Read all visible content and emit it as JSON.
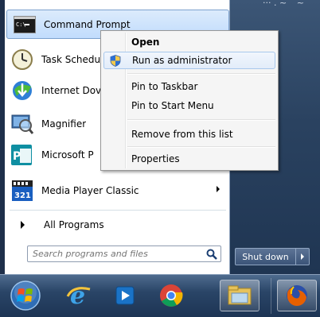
{
  "start_menu": {
    "top_right_text": "···  . ~ ˙ ~ ˙",
    "programs": [
      {
        "label": "Command Prompt",
        "icon": "command-prompt-icon"
      },
      {
        "label": "Task Schedu",
        "icon": "task-scheduler-icon"
      },
      {
        "label": "Internet Dov",
        "icon": "internet-download-icon"
      },
      {
        "label": "Magnifier",
        "icon": "magnifier-icon"
      },
      {
        "label": "Microsoft P",
        "icon": "microsoft-publisher-icon"
      },
      {
        "label": "Media Player Classic",
        "icon": "media-player-classic-icon"
      }
    ],
    "all_programs": "All Programs",
    "search_placeholder": "Search programs and files",
    "shutdown_label": "Shut down"
  },
  "context_menu": {
    "items": [
      {
        "label": "Open"
      },
      {
        "label": "Run as administrator"
      },
      {
        "label": "Pin to Taskbar"
      },
      {
        "label": "Pin to Start Menu"
      },
      {
        "label": "Remove from this list"
      },
      {
        "label": "Properties"
      }
    ]
  },
  "taskbar": {
    "items": [
      "start-orb-icon",
      "internet-explorer-icon",
      "media-player-icon",
      "chrome-icon",
      "file-explorer-icon",
      "firefox-icon"
    ]
  },
  "colors": {
    "highlight": "#c1dcfc",
    "taskbar": "#2a4567",
    "menu_bg": "#f5f5f5"
  }
}
